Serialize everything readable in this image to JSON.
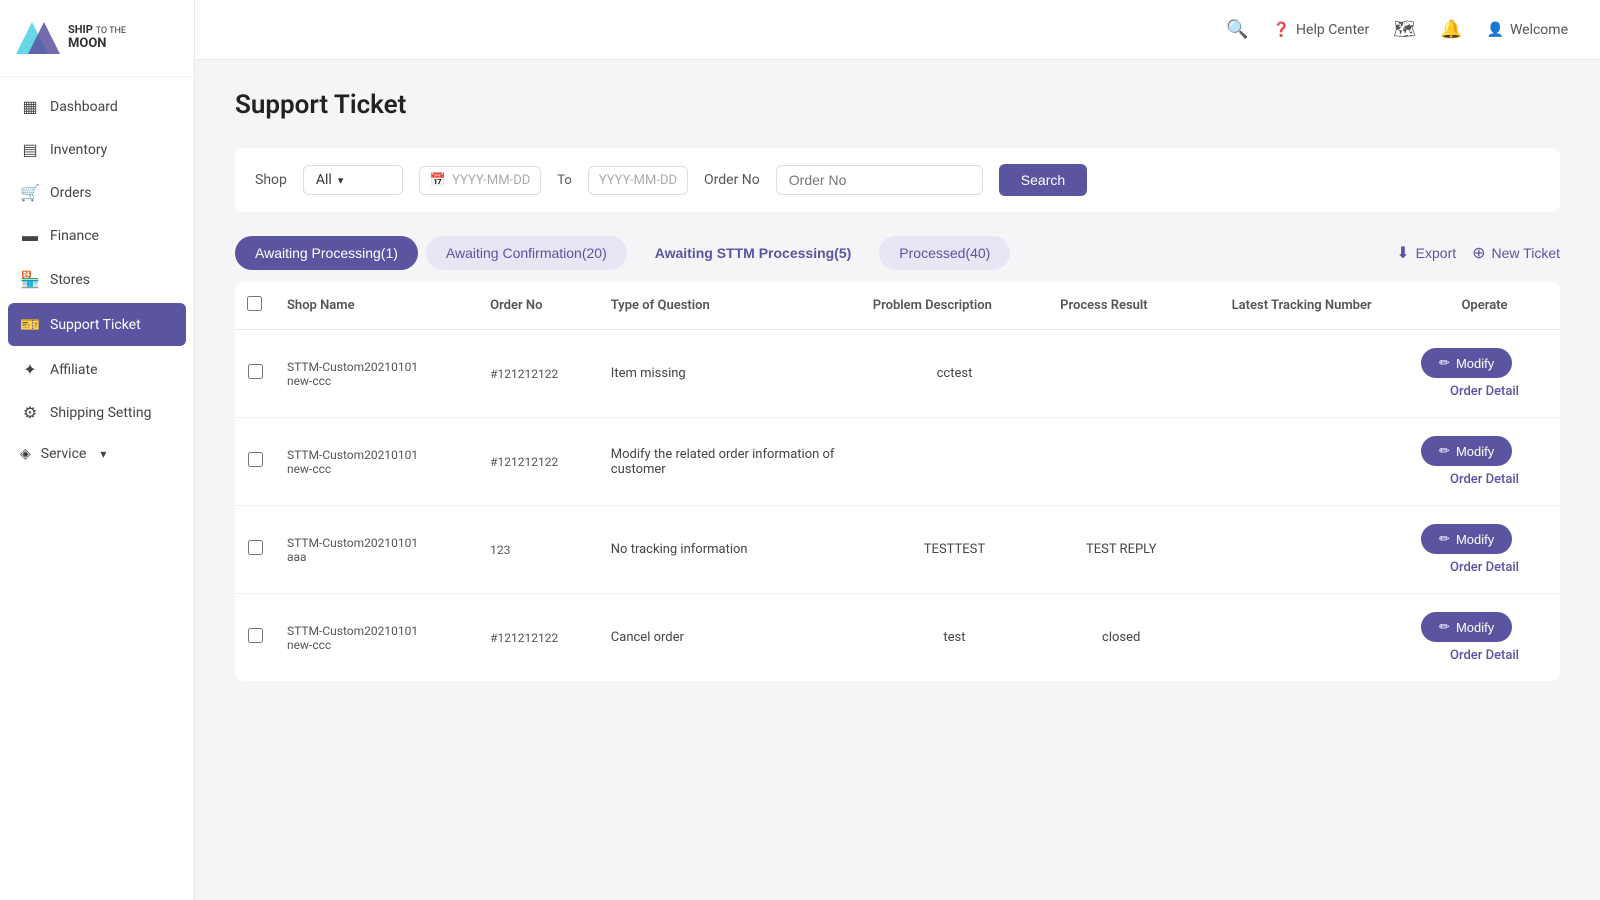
{
  "app": {
    "name": "Ship To The Moon"
  },
  "sidebar": {
    "items": [
      {
        "id": "dashboard",
        "label": "Dashboard",
        "icon": "▦",
        "active": false
      },
      {
        "id": "inventory",
        "label": "Inventory",
        "icon": "▤",
        "active": false
      },
      {
        "id": "orders",
        "label": "Orders",
        "icon": "🛒",
        "active": false
      },
      {
        "id": "finance",
        "label": "Finance",
        "icon": "▬",
        "active": false
      },
      {
        "id": "stores",
        "label": "Stores",
        "icon": "🏪",
        "active": false
      },
      {
        "id": "support-ticket",
        "label": "Support Ticket",
        "icon": "🎫",
        "active": true
      },
      {
        "id": "affiliate",
        "label": "Affiliate",
        "icon": "✦",
        "active": false
      },
      {
        "id": "shipping-setting",
        "label": "Shipping Setting",
        "icon": "⚙",
        "active": false
      }
    ],
    "service_label": "Service"
  },
  "header": {
    "help_center_label": "Help Center",
    "welcome_label": "Welcome"
  },
  "page": {
    "title": "Support Ticket"
  },
  "filters": {
    "shop_label": "Shop",
    "shop_value": "All",
    "date_from_placeholder": "YYYY-MM-DD",
    "date_to_label": "To",
    "date_to_placeholder": "YYYY-MM-DD",
    "order_no_label": "Order No",
    "order_no_placeholder": "Order No",
    "search_label": "Search"
  },
  "tabs": [
    {
      "id": "awaiting-processing",
      "label": "Awaiting Processing(1)",
      "style": "active"
    },
    {
      "id": "awaiting-confirmation",
      "label": "Awaiting Confirmation(20)",
      "style": "light"
    },
    {
      "id": "awaiting-sttm",
      "label": "Awaiting STTM Processing(5)",
      "style": "outline"
    },
    {
      "id": "processed",
      "label": "Processed(40)",
      "style": "light"
    }
  ],
  "actions": {
    "export_label": "Export",
    "new_ticket_label": "New Ticket"
  },
  "table": {
    "columns": [
      {
        "id": "checkbox",
        "label": ""
      },
      {
        "id": "shop-name",
        "label": "Shop Name"
      },
      {
        "id": "order-no",
        "label": "Order No"
      },
      {
        "id": "type-of-question",
        "label": "Type of Question"
      },
      {
        "id": "problem-description",
        "label": "Problem Description"
      },
      {
        "id": "process-result",
        "label": "Process Result"
      },
      {
        "id": "latest-tracking",
        "label": "Latest Tracking Number"
      },
      {
        "id": "operate",
        "label": "Operate"
      }
    ],
    "rows": [
      {
        "id": "row1",
        "shop_name": "STTM-Custom20210101",
        "order_no": "#121212122",
        "shop_extra": "new-ccc",
        "type_of_question": "Item missing",
        "problem_description": "cctest",
        "process_result": "",
        "latest_tracking": "",
        "modify_label": "Modify",
        "order_detail_label": "Order Detail"
      },
      {
        "id": "row2",
        "shop_name": "STTM-Custom20210101",
        "order_no": "#121212122",
        "shop_extra": "new-ccc",
        "type_of_question": "Modify the related order information of customer",
        "problem_description": "",
        "process_result": "",
        "latest_tracking": "",
        "modify_label": "Modify",
        "order_detail_label": "Order Detail"
      },
      {
        "id": "row3",
        "shop_name": "STTM-Custom20210101",
        "order_no": "123",
        "shop_extra": "aaa",
        "type_of_question": "No tracking information",
        "problem_description": "TESTTEST",
        "process_result": "TEST REPLY",
        "latest_tracking": "",
        "modify_label": "Modify",
        "order_detail_label": "Order Detail"
      },
      {
        "id": "row4",
        "shop_name": "STTM-Custom20210101",
        "order_no": "#121212122",
        "shop_extra": "new-ccc",
        "type_of_question": "Cancel order",
        "problem_description": "test",
        "process_result": "closed",
        "latest_tracking": "",
        "modify_label": "Modify",
        "order_detail_label": "Order Detail"
      }
    ]
  }
}
